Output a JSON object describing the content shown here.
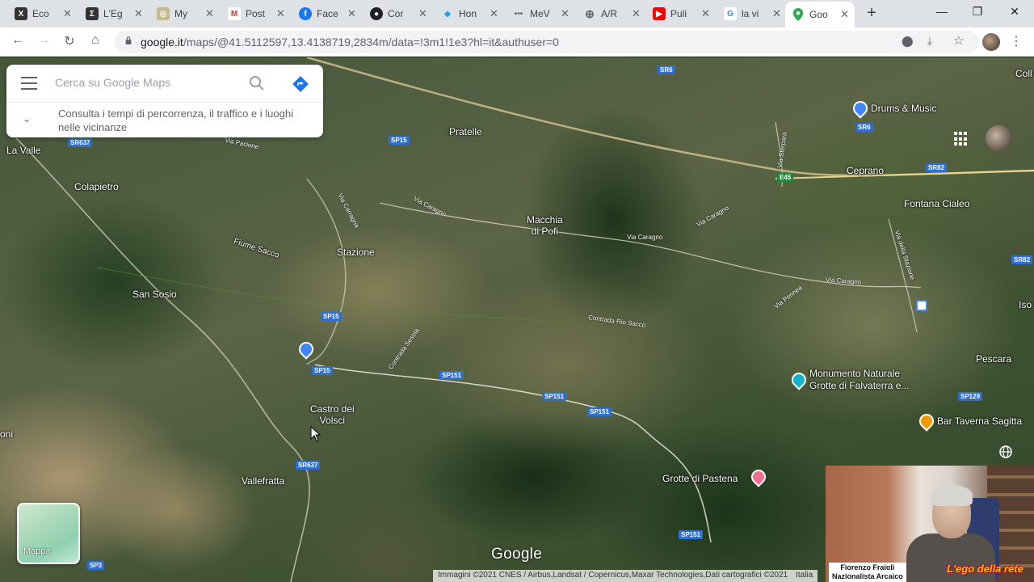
{
  "tabs": [
    {
      "title": "Eco",
      "color": "#333333",
      "glyph": "X"
    },
    {
      "title": "L'Eg",
      "color": "#333333",
      "glyph": "Σ"
    },
    {
      "title": "My ",
      "color": "#c8b98a",
      "glyph": "◎"
    },
    {
      "title": "Post",
      "color": "#d93025",
      "glyph": "M"
    },
    {
      "title": "Face",
      "color": "#1877f2",
      "glyph": "f"
    },
    {
      "title": "Cor",
      "color": "#202124",
      "glyph": "●"
    },
    {
      "title": "Hon",
      "color": "#1da1f2",
      "glyph": "🐦"
    },
    {
      "title": "MeV",
      "color": "#5f6368",
      "glyph": "•••"
    },
    {
      "title": "A/R",
      "color": "#5f6368",
      "glyph": "⊕"
    },
    {
      "title": "Puli",
      "color": "#ff0000",
      "glyph": "▶"
    },
    {
      "title": "la vi",
      "color": "#4285f4",
      "glyph": "G"
    },
    {
      "title": "Goo",
      "color": "#34a853",
      "glyph": "📍"
    }
  ],
  "window": {
    "minimize": "—",
    "restore": "❐",
    "close": "✕",
    "new_tab": "+"
  },
  "toolbar": {
    "url_host": "google.it",
    "url_path": "/maps/@41.5112597,13.4138719,2834m/data=!3m1!1e3?hl=it&authuser=0"
  },
  "search": {
    "placeholder": "Cerca su Google Maps",
    "hint": "Consulta i tempi di percorrenza, il traffico e i luoghi nelle vicinanze"
  },
  "places": {
    "la_valle": "La Valle",
    "colapietro": "Colapietro",
    "pratelle": "Pratelle",
    "macchia": "Macchia\ndi Pofi",
    "stazione": "Stazione",
    "san_sosio": "San Sosio",
    "fiume_sacco": "Fiume Sacco",
    "castro": "Castro dei\nVolsci",
    "vallefratta": "Vallefratta",
    "ceprano": "Ceprano",
    "fontana": "Fontana Cialeo",
    "pescara": "Pescara",
    "grotte_pastena": "Grotte di Pastena",
    "oni": "oni",
    "iso": "Iso",
    "coll": "Coll"
  },
  "roads": {
    "sr6": "SR6",
    "sr6b": "SR6",
    "sr637": "SR637",
    "sr637b": "SR637",
    "sp15": "SP15",
    "sp15b": "SP15",
    "sp15c": "SP15",
    "sp151a": "SP151",
    "sp151b": "SP151",
    "sp151c": "SP151",
    "sp151d": "SP151",
    "sr82": "SR82",
    "sr82b": "SR82",
    "e45": "E45",
    "sp129": "SP129",
    "sp3": "SP3",
    "via_caragno1": "Via Caragno",
    "via_caragno2": "Via Caragno",
    "via_caragno3": "Via Caragno",
    "via_caragno4": "Via Caragno",
    "via_carragna": "Via Carragna",
    "contrada_sesola": "Contrada Sesola",
    "contrada_rio": "Contrada Rio Sacco",
    "via_pennea": "Via Pennea",
    "via_stazione": "Via della Stazione",
    "via_sterpara": "Via Sterpara",
    "via_pacione": "Via Pacione"
  },
  "pois": {
    "drums": "Drums & Music",
    "monumento": "Monumento Naturale\nGrotte di Falvaterra e...",
    "bar": "Bar Taverna Sagitta"
  },
  "layer": {
    "label": "Mappa"
  },
  "footer": {
    "logo": "Google",
    "attribution": "Immagini ©2021 CNES / Airbus,Landsat / Copernicus,Maxar Technologies,Dati cartografici ©2021",
    "country": "Italia"
  },
  "webcam": {
    "caption": "Fiorenzo Fraioli\nNazionalista Arcaico",
    "brand": "L'ego della rete"
  },
  "colors": {
    "accent": "#1a73e8",
    "pin_blue": "#4285f4",
    "pin_teal": "#12b5cb",
    "pin_orange": "#f29900",
    "pin_pink": "#ee6e8d"
  }
}
